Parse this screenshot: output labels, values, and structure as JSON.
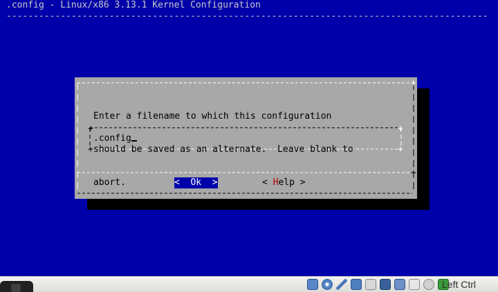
{
  "backtitle": ".config - Linux/x86 3.13.1 Kernel Configuration",
  "backtitle_rule": "-----------------------------------------------------------------------------------------",
  "dialog": {
    "text_lines": [
      "Enter a filename to which this configuration",
      "should be saved as an alternate.  Leave blank to",
      "abort."
    ],
    "input_value": ".config",
    "ok_label": "<  Ok  >",
    "help_prefix": "< ",
    "help_hotkey": "H",
    "help_rest": "elp >"
  },
  "statusbar": {
    "host_key_label": "Left Ctrl",
    "icons": [
      "hard-disk-icon",
      "optical-drive-icon",
      "usb-icon",
      "network-icon",
      "shared-folder-icon",
      "display-icon",
      "video-capture-icon",
      "cpu-icon",
      "mouse-integration-icon",
      "host-key-arrow-icon"
    ]
  },
  "colors": {
    "background": "#0000aa",
    "dialog": "#a8a8a8",
    "highlight": "#0000aa",
    "hotkey": "#aa0000"
  }
}
